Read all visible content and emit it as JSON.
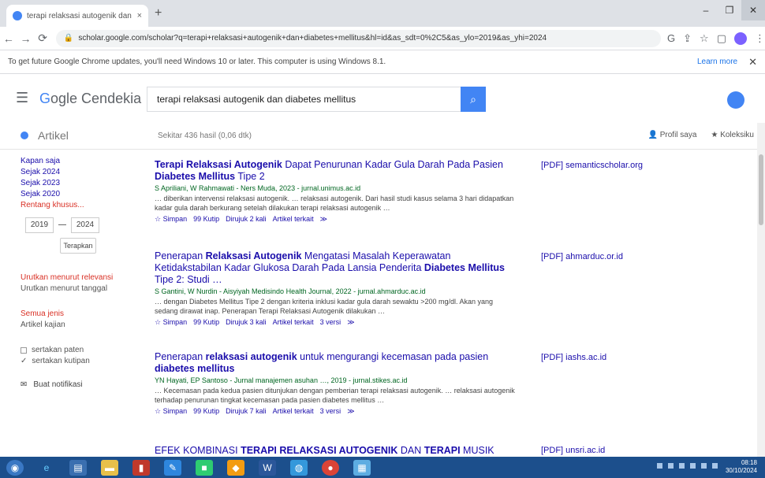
{
  "browser": {
    "tab_title": "terapi relaksasi autogenik dan d",
    "tab_close": "×",
    "new_tab": "+",
    "window_controls": [
      "–",
      "❐",
      "✕"
    ],
    "url": "scholar.google.com/scholar?q=terapi+relaksasi+autogenik+dan+diabetes+mellitus&hl=id&as_sdt=0%2C5&as_ylo=2019&as_yhi=2024",
    "infobar_message": "To get future Google Chrome updates, you'll need Windows 10 or later. This computer is using Windows 8.1.",
    "infobar_link": "Learn more"
  },
  "scholar": {
    "logo_rest": "ogle Cendekia",
    "search_query": "terapi relaksasi autogenik  dan diabetes mellitus",
    "section": "Artikel",
    "results_count": "Sekitar 436 hasil (0,06 dtk)",
    "profile_link": "Profil saya",
    "library_link": "Koleksiku"
  },
  "filters": {
    "items": [
      "Kapan saja",
      "Sejak 2024",
      "Sejak 2023",
      "Sejak 2020",
      "Rentang khusus..."
    ],
    "from": "2019",
    "to": "2024",
    "apply": "Terapkan",
    "sort_relevance": "Urutkan menurut relevansi",
    "sort_date": "Urutkan menurut tanggal",
    "any_type": "Semua jenis",
    "review": "Artikel kajian",
    "patents": "sertakan paten",
    "citations": "sertakan kutipan",
    "alert": "Buat notifikasi"
  },
  "results": [
    {
      "title_b1": "Terapi Relaksasi Autogenik",
      "title_n1": " Dapat Penurunan Kadar Gula Darah Pada Pasien ",
      "title_b2": "Diabetes Mellitus",
      "title_n2": " Tipe 2",
      "authors": "S Apriliani, W Rahmawati - Ners Muda, 2023 - jurnal.unimus.ac.id",
      "snippet": "… diberikan intervensi relaksasi autogenik. … relaksasi autogenik. Dari hasil studi kasus selama 3 hari didapatkan kadar gula darah berkurang setelah dilakukan terapi relaksasi autogenik …",
      "actions": [
        "☆ Simpan",
        "99 Kutip",
        "Dirujuk 2 kali",
        "Artikel terkait",
        "≫"
      ],
      "pdf": "[PDF] semanticscholar.org"
    },
    {
      "title_b1": "Relaksasi Autogenik",
      "title_pre": "Penerapan ",
      "title_n1": " Mengatasi Masalah Keperawatan Ketidakstabilan Kadar Glukosa Darah Pada Lansia Penderita ",
      "title_b2": "Diabetes Mellitus",
      "title_n2": " Tipe 2: Studi …",
      "authors": "S Gantini, W Nurdin - Aisyiyah Medisindo Health Journal, 2022 - jurnal.ahmarduc.ac.id",
      "snippet": "… dengan Diabetes Mellitus Tipe 2 dengan kriteria inklusi kadar gula darah sewaktu >200 mg/dl. Akan yang sedang dirawat inap. Penerapan Terapi Relaksasi Autogenik dilakukan …",
      "actions": [
        "☆ Simpan",
        "99 Kutip",
        "Dirujuk 3 kali",
        "Artikel terkait",
        "3 versi",
        "≫"
      ],
      "pdf": "[PDF] ahmarduc.or.id"
    },
    {
      "title_pre": "Penerapan ",
      "title_b1": "relaksasi autogenik",
      "title_n1": " untuk mengurangi kecemasan pada pasien ",
      "title_b2": "diabetes mellitus",
      "title_n2": "",
      "authors": "YN Hayati, EP Santoso - Jurnal manajemen asuhan …, 2019 - jurnal.stikes.ac.id",
      "snippet": "… Kecemasan pada kedua pasien ditunjukan dengan pemberian terapi relaksasi autogenik. … relaksasi autogenik terhadap penurunan tingkat kecemasan pada pasien diabetes mellitus …",
      "actions": [
        "☆ Simpan",
        "99 Kutip",
        "Dirujuk 7 kali",
        "Artikel terkait",
        "3 versi",
        "≫"
      ],
      "pdf": "[PDF] iashs.ac.id"
    },
    {
      "title_pre": "EFEK KOMBINASI ",
      "title_b1": "TERAPI RELAKSASI AUTOGENIK",
      "title_n1": " DAN ",
      "title_b2": "TERAPI",
      "title_n2": " MUSIK",
      "pdf": "[PDF] unsri.ac.id"
    }
  ],
  "taskbar": {
    "time": "08:18",
    "date": "30/10/2024"
  }
}
